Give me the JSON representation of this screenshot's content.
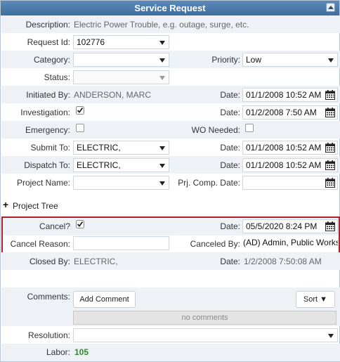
{
  "header": {
    "title": "Service Request"
  },
  "description": {
    "label": "Description:",
    "value": "Electric Power Trouble, e.g. outage, surge, etc."
  },
  "request_id": {
    "label": "Request Id:",
    "value": "102776"
  },
  "category": {
    "label": "Category:",
    "value": ""
  },
  "priority": {
    "label": "Priority:",
    "value": "Low"
  },
  "status": {
    "label": "Status:",
    "value": ""
  },
  "initiated_by": {
    "label": "Initiated By:",
    "value": "ANDERSON, MARC",
    "date_label": "Date:",
    "date": "01/1/2008 10:52 AM"
  },
  "investigation": {
    "label": "Investigation:",
    "checked": true,
    "date_label": "Date:",
    "date": "01/2/2008 7:50 AM"
  },
  "emergency": {
    "label": "Emergency:",
    "checked": false,
    "wo_label": "WO Needed:",
    "wo_checked": false
  },
  "submit_to": {
    "label": "Submit To:",
    "value": "ELECTRIC,",
    "date_label": "Date:",
    "date": "01/1/2008 10:52 AM"
  },
  "dispatch_to": {
    "label": "Dispatch To:",
    "value": "ELECTRIC,",
    "date_label": "Date:",
    "date": "01/1/2008 10:52 AM"
  },
  "project_name": {
    "label": "Project Name:",
    "value": "",
    "comp_label": "Prj. Comp. Date:",
    "comp_date": ""
  },
  "project_tree": {
    "toggle": "+",
    "label": "Project Tree"
  },
  "cancel": {
    "label": "Cancel?",
    "checked": true,
    "date_label": "Date:",
    "date": "05/5/2020 8:24 PM"
  },
  "cancel_reason": {
    "label": "Cancel Reason:",
    "value": "",
    "canceled_by_label": "Canceled By:",
    "canceled_by": "(AD) Admin, Public Works"
  },
  "closed_by": {
    "label": "Closed By:",
    "value": "ELECTRIC,",
    "date_label": "Date:",
    "date": "1/2/2008 7:50:08 AM"
  },
  "comments": {
    "label": "Comments:",
    "add_button": "Add Comment",
    "sort_button": "Sort",
    "sort_icon": "▼",
    "empty": "no comments"
  },
  "resolution": {
    "label": "Resolution:",
    "value": ""
  },
  "labor": {
    "label": "Labor:",
    "value": "105"
  },
  "colors": {
    "header": "#4a7aab",
    "highlight": "#b0202a",
    "labor": "#2e8b2e"
  }
}
